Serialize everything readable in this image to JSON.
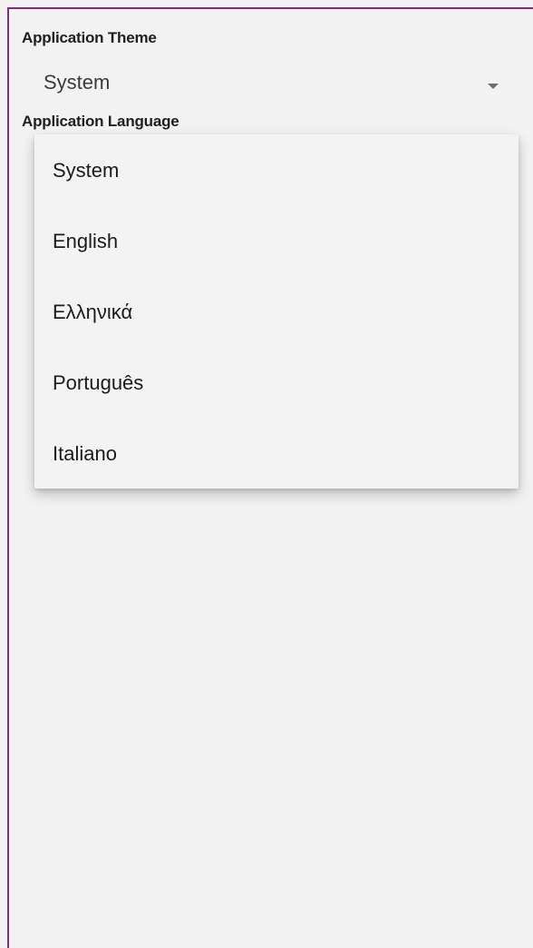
{
  "theme": {
    "label": "Application Theme",
    "selected": "System"
  },
  "language": {
    "label": "Application Language",
    "options": [
      "System",
      "English",
      "Ελληνικά",
      "Português",
      "Italiano"
    ]
  },
  "icons": {
    "theme_dropdown": "chevron-down-icon"
  },
  "colors": {
    "background": "#f2f2f2",
    "frame_border": "#8b2a72",
    "menu_background": "#f3f3f3"
  }
}
